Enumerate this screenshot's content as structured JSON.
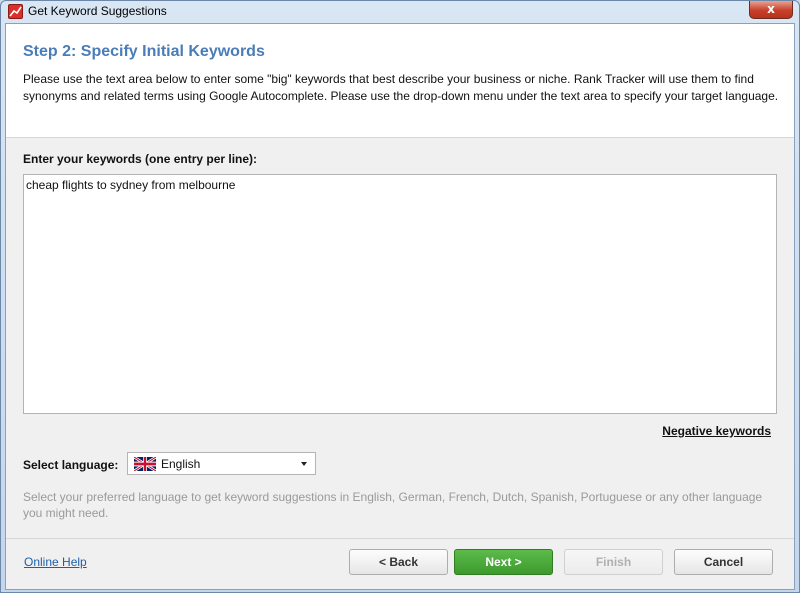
{
  "window": {
    "title": "Get Keyword Suggestions",
    "close_glyph": "x"
  },
  "header": {
    "step_title": "Step 2: Specify Initial Keywords",
    "description": "Please use the text area below to enter some \"big\" keywords that best describe your business or niche. Rank Tracker will use them to find synonyms and related terms using Google Autocomplete. Please use the drop-down menu under the text area to specify your target language."
  },
  "keywords": {
    "label": "Enter your keywords (one entry per line):",
    "value": "cheap flights to sydney from melbourne"
  },
  "negative_keywords_link": "Negative keywords",
  "language": {
    "label": "Select language:",
    "selected": "English",
    "flag_icon": "uk-flag-icon",
    "hint": "Select your preferred language to get keyword suggestions in English, German, French, Dutch, Spanish, Portuguese or any other language you might need."
  },
  "footer": {
    "help_link": "Online Help",
    "back_label": "< Back",
    "next_label": "Next >",
    "finish_label": "Finish",
    "cancel_label": "Cancel"
  },
  "colors": {
    "accent_title": "#4a7db8",
    "next_button": "#4aa63a",
    "link": "#1f5fa8",
    "hint_text": "#9a9a9a"
  }
}
